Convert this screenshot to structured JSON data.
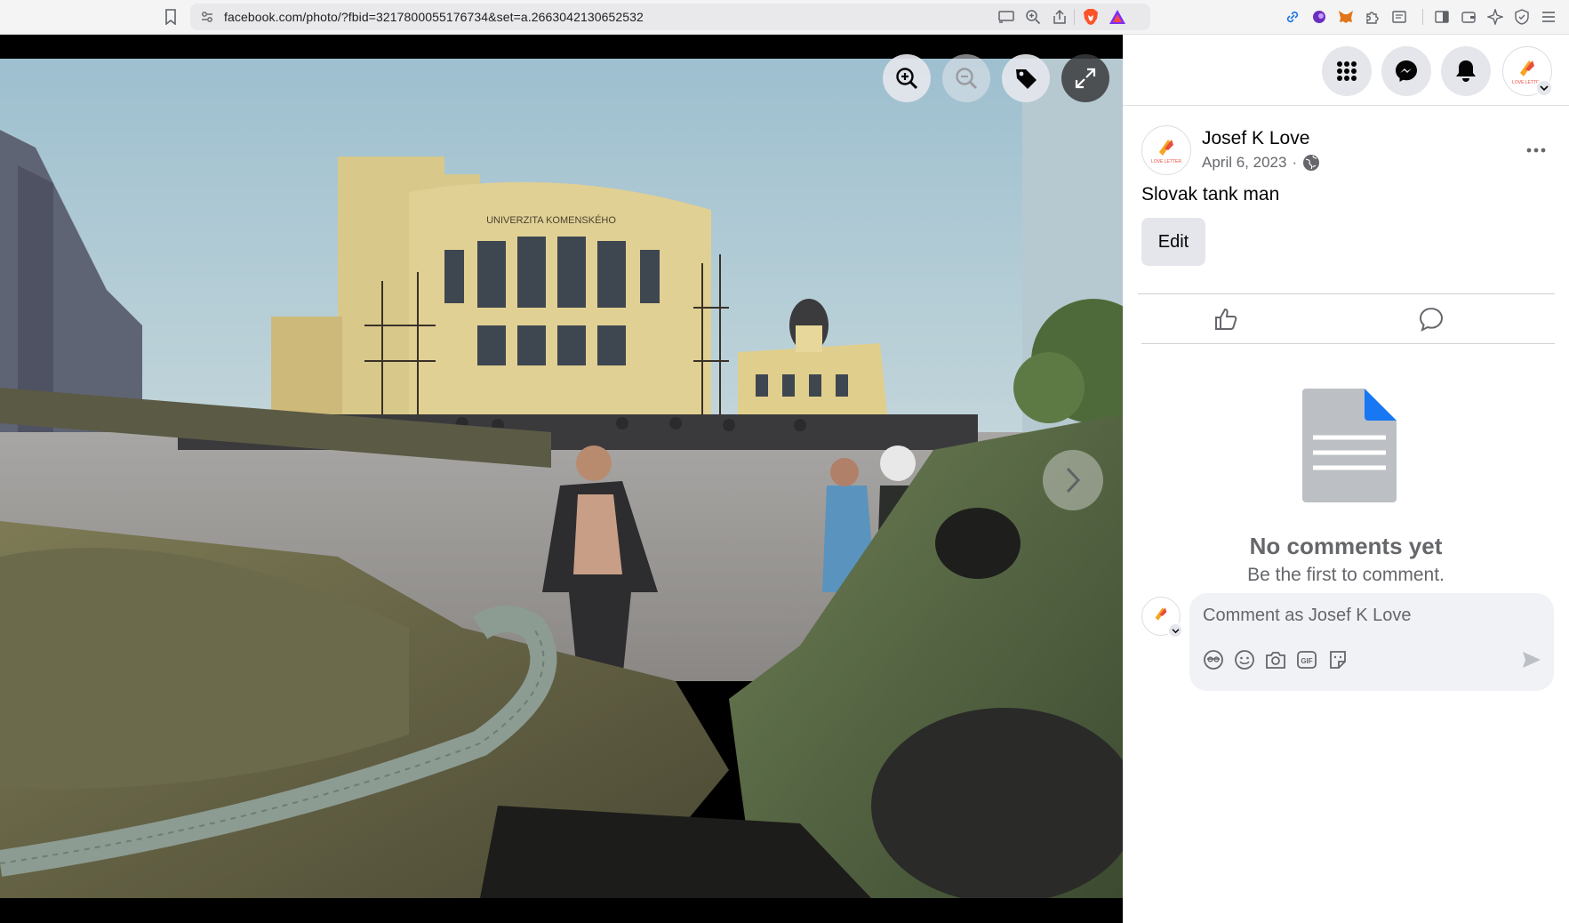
{
  "browser": {
    "url": "facebook.com/photo/?fbid=3217800055176734&set=a.2663042130652532",
    "icons": [
      "bookmark-icon",
      "site-info-icon",
      "cast-icon",
      "zoom-icon",
      "share-icon",
      "brave-shields-icon",
      "brave-rewards-icon",
      "link-icon",
      "extension-purple-icon",
      "metamask-icon",
      "puzzle-icon",
      "reader-icon",
      "sidebar-icon",
      "wallet-icon",
      "leo-icon",
      "vpn-icon",
      "menu-icon"
    ]
  },
  "viewer": {
    "controls": [
      "zoom-in-icon",
      "zoom-out-icon",
      "tag-icon",
      "fullscreen-icon"
    ],
    "next_icon": "chevron-right-icon"
  },
  "nav": {
    "icons": [
      "menu-grid-icon",
      "messenger-icon",
      "notifications-icon",
      "account-avatar"
    ]
  },
  "post": {
    "author": "Josef K Love",
    "date": "April 6, 2023",
    "date_sep": "·",
    "privacy_icon": "globe-icon",
    "caption": "Slovak tank man",
    "edit_label": "Edit"
  },
  "actions": {
    "like_icon": "like-icon",
    "comment_icon": "comment-icon"
  },
  "comments": {
    "empty_title": "No comments yet",
    "empty_subtitle": "Be the first to comment.",
    "placeholder": "Comment as Josef K Love",
    "tools": [
      "avatar-sticker-icon",
      "emoji-icon",
      "camera-icon",
      "gif-icon",
      "sticker-icon"
    ],
    "send_icon": "send-icon"
  },
  "colors": {
    "facebook_blue": "#1877f2",
    "secondary_text": "#65676b",
    "button_bg": "#e4e6eb"
  }
}
